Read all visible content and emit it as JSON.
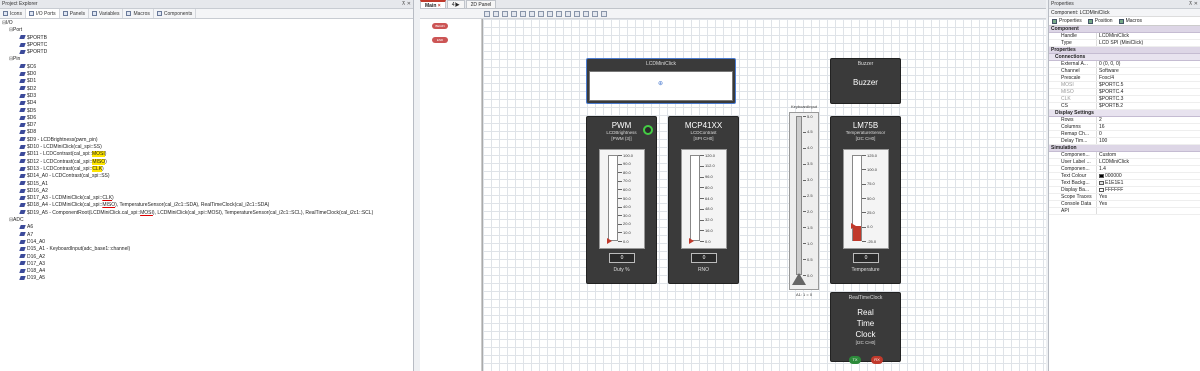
{
  "explorer": {
    "title": "Project Explorer",
    "tabs": [
      "Icons",
      "I/O Ports",
      "Panels",
      "Variables",
      "Macros",
      "Components"
    ],
    "tree": [
      {
        "indent": 0,
        "ex": "⊟",
        "text": "I/O",
        "icon": false
      },
      {
        "indent": 1,
        "ex": "⊟",
        "text": "Port",
        "icon": false
      },
      {
        "indent": 2,
        "ex": "",
        "text": "$PORTB",
        "icon": true
      },
      {
        "indent": 2,
        "ex": "",
        "text": "$PORTC",
        "icon": true
      },
      {
        "indent": 2,
        "ex": "",
        "text": "$PORTD",
        "icon": true
      },
      {
        "indent": 1,
        "ex": "⊟",
        "text": "Pin",
        "icon": false
      },
      {
        "indent": 2,
        "ex": "",
        "text": "$C6",
        "icon": true
      },
      {
        "indent": 2,
        "ex": "",
        "text": "$D0",
        "icon": true
      },
      {
        "indent": 2,
        "ex": "",
        "text": "$D1",
        "icon": true
      },
      {
        "indent": 2,
        "ex": "",
        "text": "$D2",
        "icon": true
      },
      {
        "indent": 2,
        "ex": "",
        "text": "$D3",
        "icon": true
      },
      {
        "indent": 2,
        "ex": "",
        "text": "$D4",
        "icon": true
      },
      {
        "indent": 2,
        "ex": "",
        "text": "$D5",
        "icon": true
      },
      {
        "indent": 2,
        "ex": "",
        "text": "$D6",
        "icon": true
      },
      {
        "indent": 2,
        "ex": "",
        "text": "$D7",
        "icon": true
      },
      {
        "indent": 2,
        "ex": "",
        "text": "$D8",
        "icon": true
      },
      {
        "indent": 2,
        "ex": "",
        "text": "$D9 - LCDBrightness(pwm_pin)",
        "icon": true
      },
      {
        "indent": 2,
        "ex": "",
        "text": "$D10 - LCDMiniClick(cal_spi::SS)",
        "icon": true
      },
      {
        "indent": 2,
        "ex": "",
        "pre": "$D11 - LCDContrast(cal_spi::",
        "hl": "MOSI",
        "post": ")",
        "icon": true
      },
      {
        "indent": 2,
        "ex": "",
        "pre": "$D12 - LCDContrast(cal_spi::",
        "hl": "MISO",
        "post": ")",
        "icon": true
      },
      {
        "indent": 2,
        "ex": "",
        "pre": "$D13 - LCDContrast(cal_spi::",
        "hl": "CLK",
        "post": ")",
        "icon": true
      },
      {
        "indent": 2,
        "ex": "",
        "text": "$D14_A0 - LCDContrast(cal_spi::SS)",
        "icon": true
      },
      {
        "indent": 2,
        "ex": "",
        "text": "$D15_A1",
        "icon": true
      },
      {
        "indent": 2,
        "ex": "",
        "text": "$D16_A2",
        "icon": true
      },
      {
        "indent": 2,
        "ex": "",
        "pre": "$D17_A3 - LCDMiniClick(cal_spi::",
        "ul": "CLK",
        "post": ")",
        "icon": true
      },
      {
        "indent": 2,
        "ex": "",
        "pre": "$D18_A4 - LCDMiniClick(cal_spi::",
        "ul": "MISO",
        "post": "), TemperatureSensor(cal_i2c1::SDA), RealTimeClock(cal_i2c1::SDA)",
        "icon": true
      },
      {
        "indent": 2,
        "ex": "",
        "pre": "$D19_A5 - ComponentRoot(LCDMiniClick.cal_spi::",
        "ul": "MOSI",
        "post": "), LCDMiniClick(cal_spi::MOSI), TemperatureSensor(cal_i2c1::SCL), RealTimeClock(cal_i2c1::SCL)",
        "icon": true
      },
      {
        "indent": 1,
        "ex": "⊟",
        "text": "ADC",
        "icon": false
      },
      {
        "indent": 2,
        "ex": "",
        "text": "A6",
        "icon": true
      },
      {
        "indent": 2,
        "ex": "",
        "text": "A7",
        "icon": true
      },
      {
        "indent": 2,
        "ex": "",
        "text": "D14_A0",
        "icon": true
      },
      {
        "indent": 2,
        "ex": "",
        "text": "D15_A1 - KeyboardInput(adc_base1::channel)",
        "icon": true
      },
      {
        "indent": 2,
        "ex": "",
        "text": "D16_A2",
        "icon": true
      },
      {
        "indent": 2,
        "ex": "",
        "text": "D17_A3",
        "icon": true
      },
      {
        "indent": 2,
        "ex": "",
        "text": "D18_A4",
        "icon": true
      },
      {
        "indent": 2,
        "ex": "",
        "text": "D19_A5",
        "icon": true
      }
    ]
  },
  "doc": {
    "tab_main": "Main",
    "tab_main_close": "×",
    "tab_panel": "2D Panel",
    "tab_icon": "4|▶"
  },
  "flow": {
    "begin": "BEGIN",
    "end": "END"
  },
  "lcd": {
    "title": "LCDMiniClick"
  },
  "buzzer": {
    "title": "Buzzer",
    "name": "Buzzer"
  },
  "pwm": {
    "big": "PWM",
    "sub1": "LCDBrightness",
    "sub2": "[PWM (3)]",
    "value": "0",
    "bottom": "Duty %",
    "ticks": [
      "100.0",
      "90.0",
      "80.0",
      "70.0",
      "60.0",
      "50.0",
      "40.0",
      "30.0",
      "20.0",
      "10.0",
      "0.0"
    ],
    "level": 0
  },
  "mcp": {
    "big": "MCP41XX",
    "sub1": "LCDContrast",
    "sub2": "[SPI CH0]",
    "value": "0",
    "bottom": "RNO",
    "ticks": [
      "120.0",
      "112.0",
      "96.0",
      "80.0",
      "64.0",
      "48.0",
      "32.0",
      "16.0",
      "0.0"
    ],
    "level": 0
  },
  "keyboard": {
    "title": "KeyboardInput",
    "ticks": [
      "5.0",
      "4.5",
      "4.0",
      "3.5",
      "3.0",
      "2.5",
      "2.0",
      "1.5",
      "1.0",
      "0.5",
      "0.0"
    ],
    "bottom": "A1: 1 = 0",
    "level": 0
  },
  "lm75": {
    "big": "LM75B",
    "sub1": "TemperatureSensor",
    "sub2": "[I2C CH0]",
    "value": "0",
    "bottom": "Temperature",
    "ticks": [
      "125.0",
      "100.0",
      "75.0",
      "50.0",
      "25.0",
      "0.0",
      "-25.0"
    ],
    "level": 0.17
  },
  "rtc": {
    "title": "RealTimeClock",
    "l1": "Real",
    "l2": "Time",
    "l3": "Clock",
    "ch": "[I2C CH0]",
    "tx": "TX",
    "rx": "RX"
  },
  "props": {
    "title": "Properties",
    "component_label": "Component: LCDMiniClick",
    "tabs": [
      "Properties",
      "Position",
      "Macros"
    ],
    "sections": [
      {
        "type": "group",
        "label": "Component"
      },
      {
        "type": "row",
        "k": "Handle",
        "v": "LCDMiniClick"
      },
      {
        "type": "row",
        "k": "Type",
        "v": "LCD SPI (MiniClick)"
      },
      {
        "type": "group",
        "label": "Properties"
      },
      {
        "type": "group2",
        "label": "Connections"
      },
      {
        "type": "row",
        "k": "External A...",
        "v": "0 (0, 0, 0)"
      },
      {
        "type": "row",
        "k": "Channel",
        "v": "Software"
      },
      {
        "type": "row",
        "k": "Prescale",
        "v": "Fosc/4"
      },
      {
        "type": "row",
        "k": "MOSI",
        "v": "$PORTC.5",
        "dim": true
      },
      {
        "type": "row",
        "k": "MISO",
        "v": "$PORTC.4",
        "dim": true
      },
      {
        "type": "row",
        "k": "CLK",
        "v": "$PORTC.3",
        "dim": true
      },
      {
        "type": "row",
        "k": "CS",
        "v": "$PORTB.2"
      },
      {
        "type": "group2",
        "label": "Display Settings"
      },
      {
        "type": "row",
        "k": "Rows",
        "v": "2"
      },
      {
        "type": "row",
        "k": "Columns",
        "v": "16"
      },
      {
        "type": "row",
        "k": "Remap Ch...",
        "v": "0"
      },
      {
        "type": "row",
        "k": "Delay Tim...",
        "v": "100"
      },
      {
        "type": "group",
        "label": "Simulation"
      },
      {
        "type": "row",
        "k": "Componen...",
        "v": "Custom"
      },
      {
        "type": "row",
        "k": "User Label ...",
        "v": "LCDMiniClick"
      },
      {
        "type": "row",
        "k": "Componen...",
        "v": "1.4"
      },
      {
        "type": "row",
        "k": "Text Colour",
        "v": "000000",
        "swatch": "#000000"
      },
      {
        "type": "row",
        "k": "Text Backg...",
        "v": "E1E1E1",
        "swatch": "#E1E1E1"
      },
      {
        "type": "row",
        "k": "Display Ba...",
        "v": "FFFFFF",
        "swatch": "#FFFFFF"
      },
      {
        "type": "row",
        "k": "Scope Traces",
        "v": "Yes"
      },
      {
        "type": "row",
        "k": "Console Data",
        "v": "Yes"
      },
      {
        "type": "row",
        "k": "API",
        "v": ""
      }
    ]
  },
  "colors": {
    "accent": "#c0392b",
    "pointer": "#c0392b",
    "selection": "#4a7bd0",
    "highlight": "#ffe600"
  }
}
